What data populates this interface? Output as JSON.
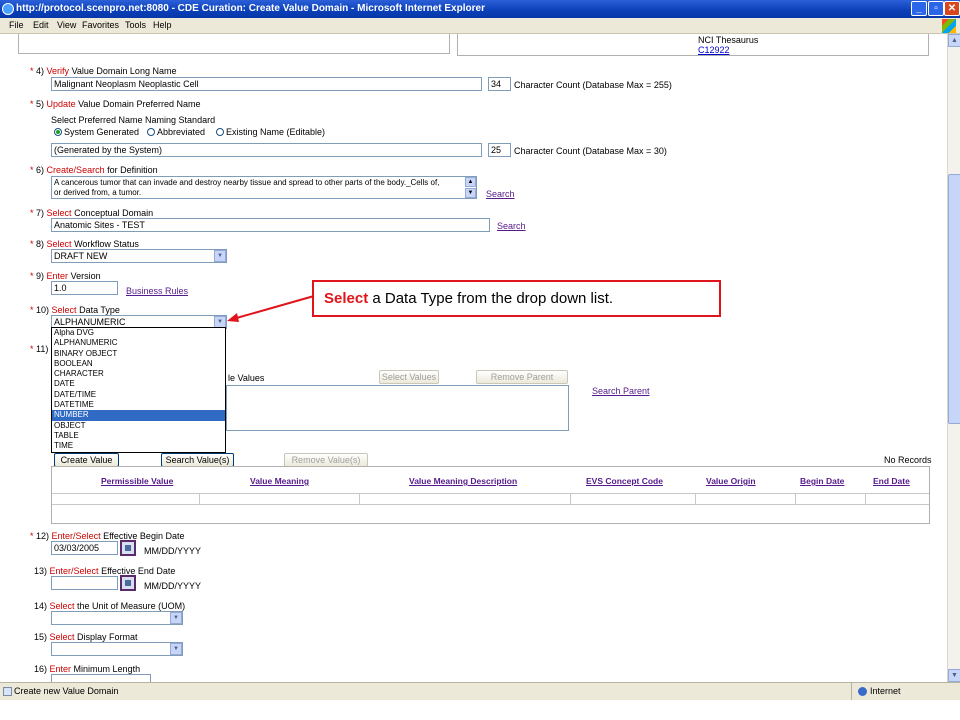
{
  "window": {
    "title": "http://protocol.scenpro.net:8080 - CDE Curation: Create Value Domain - Microsoft Internet Explorer",
    "minimize": "_",
    "maximize": "▫",
    "close": "✕"
  },
  "menu": {
    "items": [
      "File",
      "Edit",
      "View",
      "Favorites",
      "Tools",
      "Help"
    ]
  },
  "top_box": {
    "nci_label": "NCI Thesaurus",
    "nci_code": "C12922"
  },
  "step4": {
    "num": "4)",
    "action": "Verify",
    "label": " Value Domain Long Name",
    "value": "Malignant Neoplasm Neoplastic Cell",
    "count": "34",
    "count_label": "Character Count   (Database Max = 255)"
  },
  "step5": {
    "num": "5)",
    "action": "Update",
    "label": " Value Domain Preferred Name",
    "standard_label": "Select Preferred Name Naming Standard",
    "options": [
      "System Generated",
      "Abbreviated",
      "Existing Name (Editable)"
    ],
    "value": "(Generated by the System)",
    "count": "25",
    "count_label": "Character Count   (Database Max = 30)"
  },
  "step6": {
    "num": "6)",
    "action": "Create/Search",
    "label": " for Definition",
    "line1": "A cancerous tumor that can invade and destroy nearby tissue and spread to other parts of the body._Cells of,",
    "line2": "or derived from, a tumor.",
    "search": "Search"
  },
  "step7": {
    "num": "7)",
    "action": "Select",
    "label": " Conceptual Domain",
    "value": "Anatomic Sites - TEST",
    "search": "Search"
  },
  "step8": {
    "num": "8)",
    "action": "Select",
    "label": " Workflow Status",
    "value": "DRAFT NEW"
  },
  "step9": {
    "num": "9)",
    "action": "Enter",
    "label": " Version",
    "value": "1.0",
    "link": "Business Rules"
  },
  "step10": {
    "num": "10)",
    "action": "Select",
    "label": " Data Type",
    "value": "ALPHANUMERIC",
    "options": [
      "Alpha DVG",
      "ALPHANUMERIC",
      "BINARY OBJECT",
      "BOOLEAN",
      "CHARACTER",
      "DATE",
      "DATE/TIME",
      "DATETIME",
      "NUMBER",
      "OBJECT",
      "TABLE",
      "TIME"
    ],
    "selected_option": "NUMBER"
  },
  "step11": {
    "num": "11)",
    "values_label": "le Values",
    "select_values": "Select Values",
    "remove_parent": "Remove Parent",
    "search_parent": "Search Parent",
    "create_value": "Create Value",
    "search_values": "Search Value(s)",
    "remove_values": "Remove Value(s)",
    "no_records": "No Records"
  },
  "grid": {
    "headers": [
      "Permissible Value",
      "Value Meaning",
      "Value Meaning Description",
      "EVS Concept Code",
      "Value Origin",
      "Begin Date",
      "End Date"
    ]
  },
  "step12": {
    "num": "12)",
    "action": "Enter/Select",
    "label": " Effective Begin Date",
    "value": "03/03/2005",
    "format": "MM/DD/YYYY"
  },
  "step13": {
    "num": "13)",
    "action": "Enter/Select",
    "label": " Effective End Date",
    "value": "",
    "format": "MM/DD/YYYY"
  },
  "step14": {
    "num": "14)",
    "action": "Select",
    "label": " the Unit of Measure (UOM)"
  },
  "step15": {
    "num": "15)",
    "action": "Select",
    "label": " Display Format"
  },
  "step16": {
    "num": "16)",
    "action": "Enter",
    "label": " Minimum Length"
  },
  "callout": {
    "bold": "Select",
    "rest": " a Data Type from the drop down list."
  },
  "status": {
    "text": "Create new Value Domain",
    "zone": "Internet"
  },
  "colors": {
    "required": "#cc0000",
    "callout_border": "#e0151b",
    "titlebar": "#0a3fb8",
    "selection": "#316ac5"
  }
}
